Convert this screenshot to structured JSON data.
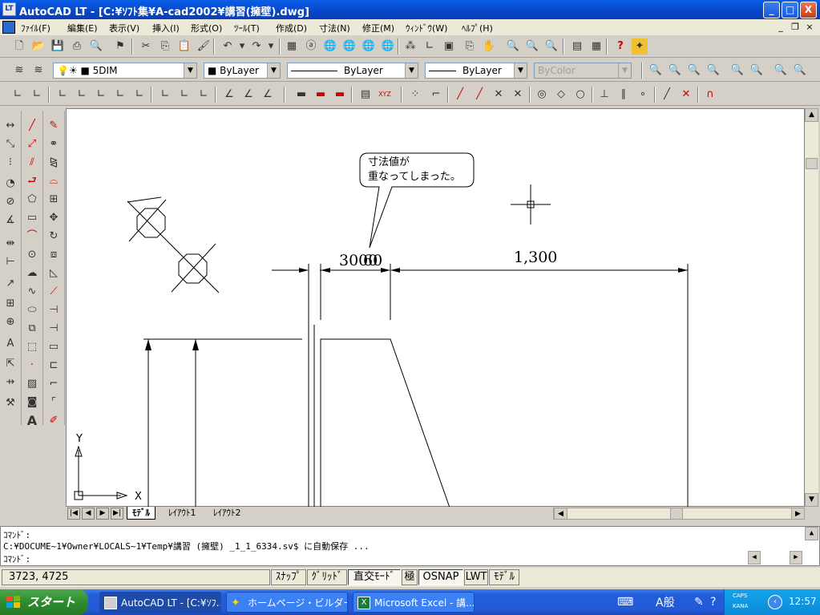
{
  "window": {
    "title": "AutoCAD LT - [C:¥ｿﾌﾄ集¥A-cad2002¥講習(擁壁).dwg]",
    "app_icon": "LT",
    "buttons": {
      "minimize": "_",
      "maximize": "□",
      "close": "X"
    }
  },
  "menubar": {
    "items": [
      "ﾌｧｲﾙ(F)",
      "編集(E)",
      "表示(V)",
      "挿入(I)",
      "形式(O)",
      "ﾂｰﾙ(T)",
      "作成(D)",
      "寸法(N)",
      "修正(M)",
      "ｳｨﾝﾄﾞｳ(W)",
      "ﾍﾙﾌﾟ(H)"
    ],
    "mdi_buttons": [
      "_",
      "❐",
      "×"
    ]
  },
  "layer_toolbar": {
    "layer_value": "5DIM",
    "color_value": "ByLayer",
    "linetype_value": "ByLayer",
    "lineweight_value": "ByLayer",
    "plotstyle_value": "ByColor"
  },
  "drawing": {
    "callout_line1": "寸法値が",
    "callout_line2": "重なってしまった。",
    "dim_text_left": "3000",
    "dim_text_overlap": "60",
    "dim_text_right": "1,300",
    "ucs_x": "X",
    "ucs_y": "Y"
  },
  "layout_tabs": [
    "ﾓﾃﾞﾙ",
    "ﾚｲｱｳﾄ1",
    "ﾚｲｱｳﾄ2"
  ],
  "command": {
    "line1": "ｺﾏﾝﾄﾞ:",
    "line2": "C:¥DOCUME~1¥Owner¥LOCALS~1¥Temp¥講習 (擁壁) _1_1_6334.sv$ に自動保存 ...",
    "prompt": "ｺﾏﾝﾄﾞ:"
  },
  "status": {
    "coords": "3723, 4725",
    "toggles": [
      "ｽﾅｯﾌﾟ",
      "ｸﾞﾘｯﾄﾞ",
      "直交ﾓｰﾄﾞ",
      "極",
      "OSNAP",
      "LWT",
      "ﾓﾃﾞﾙ"
    ]
  },
  "taskbar": {
    "start": "スタート",
    "tasks": [
      "AutoCAD LT - [C:¥ｿﾌ...",
      "ホームページ・ビルダー",
      "Microsoft Excel - 講..."
    ],
    "ime": "A般",
    "caps": "CAPS",
    "kana": "KANA",
    "clock": "12:57"
  }
}
